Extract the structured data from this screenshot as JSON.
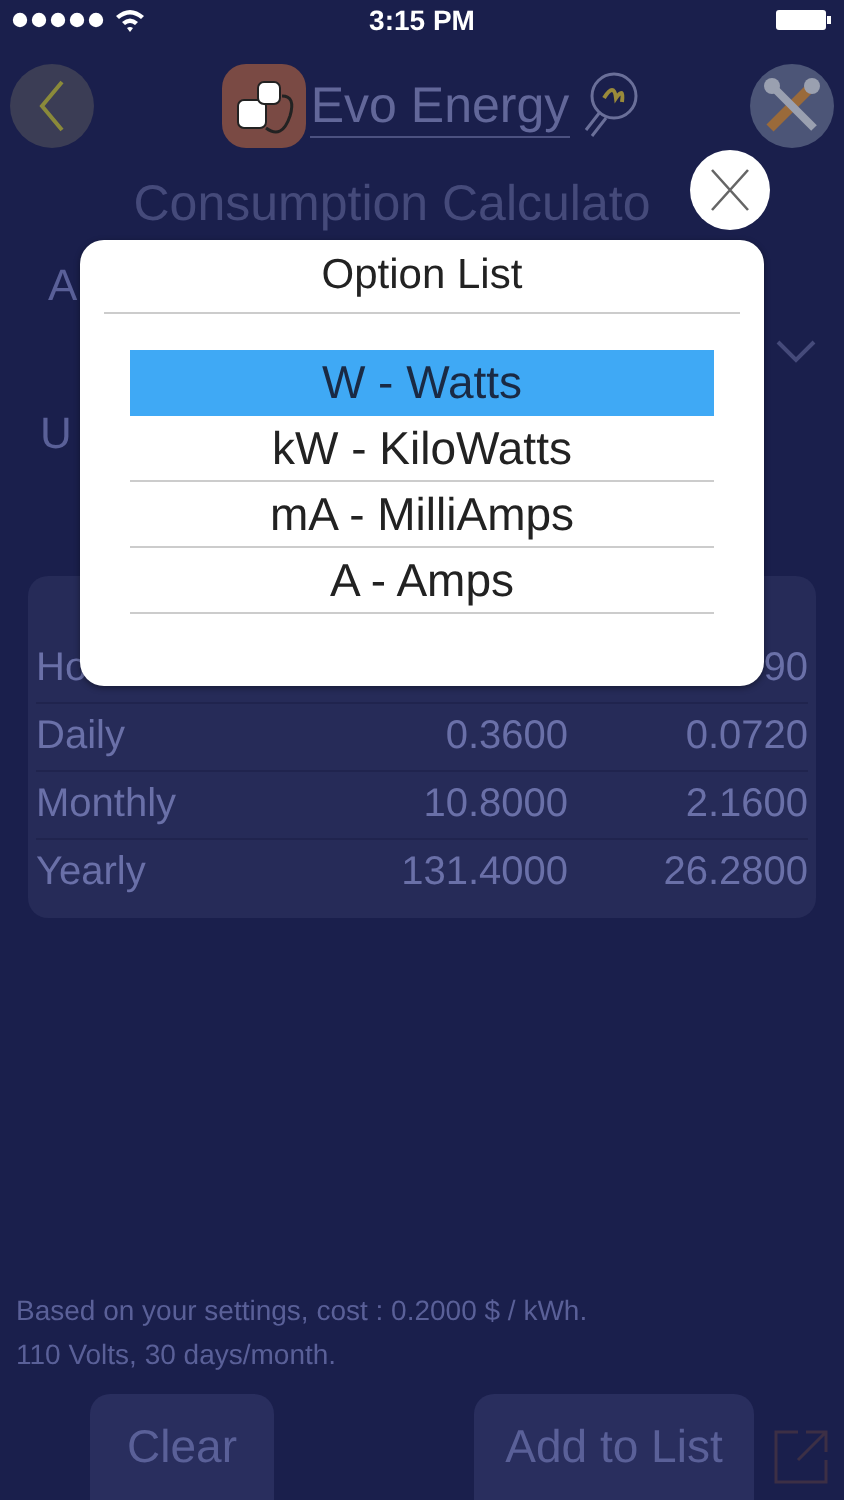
{
  "status_bar": {
    "time": "3:15 PM"
  },
  "header": {
    "app_name": "Evo Energy"
  },
  "title": "Consumption Calculato",
  "form": {
    "label_1": "A",
    "label_2": "U"
  },
  "table": {
    "rows": [
      {
        "label": "Ho",
        "value_2": "90"
      },
      {
        "label": "Daily",
        "value_1": "0.3600",
        "value_2": "0.0720"
      },
      {
        "label": "Monthly",
        "value_1": "10.8000",
        "value_2": "2.1600"
      },
      {
        "label": "Yearly",
        "value_1": "131.4000",
        "value_2": "26.2800"
      }
    ]
  },
  "footer_note": [
    "Based on your settings, cost : 0.2000 $ / kWh.",
    "110 Volts, 30 days/month."
  ],
  "buttons": [
    "Clear",
    "Add to List"
  ],
  "dialog": {
    "title": "Option List",
    "options": [
      {
        "label": "W - Watts",
        "selected": true
      },
      {
        "label": "kW - KiloWatts",
        "selected": false
      },
      {
        "label": "mA - MilliAmps",
        "selected": false
      },
      {
        "label": "A - Amps",
        "selected": false
      }
    ]
  }
}
